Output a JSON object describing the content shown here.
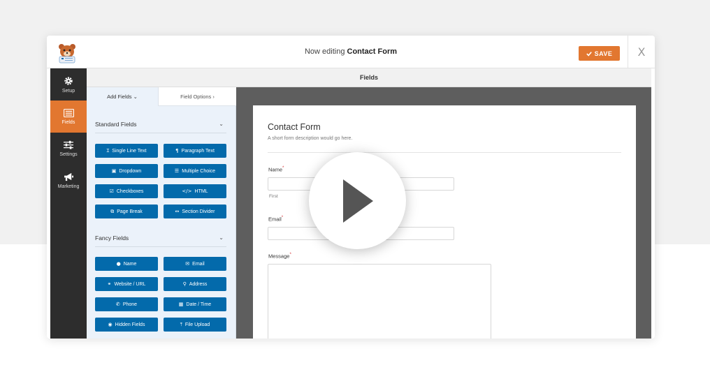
{
  "header": {
    "title_prefix": "Now editing ",
    "title_form": "Contact Form",
    "save_label": "SAVE",
    "close_label": "X"
  },
  "sidebar": {
    "items": [
      {
        "label": "Setup",
        "icon": "gear-icon"
      },
      {
        "label": "Fields",
        "icon": "list-icon",
        "active": true
      },
      {
        "label": "Settings",
        "icon": "sliders-icon"
      },
      {
        "label": "Marketing",
        "icon": "megaphone-icon"
      }
    ]
  },
  "main": {
    "section_header": "Fields"
  },
  "panel": {
    "tabs": [
      "Add Fields ⌄",
      "Field Options ›"
    ],
    "standard": {
      "title": "Standard Fields",
      "buttons": [
        {
          "label": "Single Line Text",
          "icon": "text-icon"
        },
        {
          "label": "Paragraph Text",
          "icon": "paragraph-icon"
        },
        {
          "label": "Dropdown",
          "icon": "dropdown-icon"
        },
        {
          "label": "Multiple Choice",
          "icon": "list-icon"
        },
        {
          "label": "Checkboxes",
          "icon": "checkbox-icon"
        },
        {
          "label": "HTML",
          "icon": "code-icon"
        },
        {
          "label": "Page Break",
          "icon": "copy-icon"
        },
        {
          "label": "Section Divider",
          "icon": "arrows-h-icon"
        }
      ]
    },
    "fancy": {
      "title": "Fancy Fields",
      "buttons": [
        {
          "label": "Name",
          "icon": "user-icon"
        },
        {
          "label": "Email",
          "icon": "envelope-icon"
        },
        {
          "label": "Website / URL",
          "icon": "link-icon"
        },
        {
          "label": "Address",
          "icon": "map-marker-icon"
        },
        {
          "label": "Phone",
          "icon": "phone-icon"
        },
        {
          "label": "Date / Time",
          "icon": "calendar-icon"
        },
        {
          "label": "Hidden Fields",
          "icon": "eye-slash-icon"
        },
        {
          "label": "File Upload",
          "icon": "upload-icon"
        }
      ]
    }
  },
  "form": {
    "title": "Contact Form",
    "description": "A short form description would go here.",
    "name_label": "Name",
    "name_sub": "First",
    "email_label": "Email",
    "message_label": "Message",
    "required_mark": "*"
  },
  "colors": {
    "accent": "#e27730",
    "button_blue": "#036aab",
    "sidebar": "#2d2d2d",
    "preview_bg": "#5e5e5e"
  }
}
